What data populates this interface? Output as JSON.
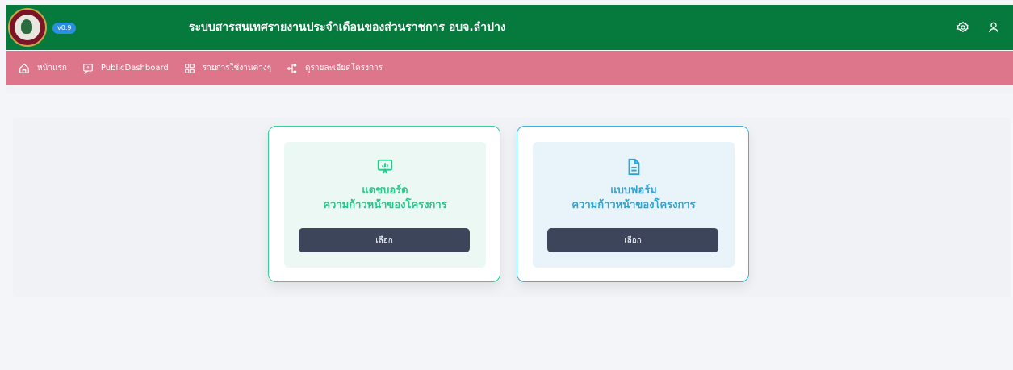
{
  "header": {
    "version": "v0.9",
    "title": "ระบบสารสนเทศรายงานประจำเดือนของส่วนราชการ อบจ.ลำปาง",
    "icons": [
      "gear-icon",
      "user-icon"
    ]
  },
  "nav": {
    "items": [
      {
        "label": "หน้าแรก",
        "icon": "home-icon"
      },
      {
        "label": "PublicDashboard",
        "icon": "chat-icon"
      },
      {
        "label": "รายการใช้งานต่างๆ",
        "icon": "grid-icon"
      },
      {
        "label": "ดูรายละเอียดโครงการ",
        "icon": "share-icon"
      }
    ]
  },
  "cards": [
    {
      "title_line1": "แดชบอร์ด",
      "title_line2": "ความก้าวหน้าของโครงการ",
      "button": "เลือก",
      "icon": "presentation-chart-icon"
    },
    {
      "title_line1": "แบบฟอร์ม",
      "title_line2": "ความก้าวหน้าของโครงการ",
      "button": "เลือก",
      "icon": "document-icon"
    }
  ],
  "colors": {
    "header_bg": "#067a3d",
    "nav_bg": "#dd768a",
    "card1_accent": "#22c98a",
    "card2_accent": "#2ba4d4",
    "button_bg": "#3c4559",
    "version_badge": "#2b8fe0"
  }
}
